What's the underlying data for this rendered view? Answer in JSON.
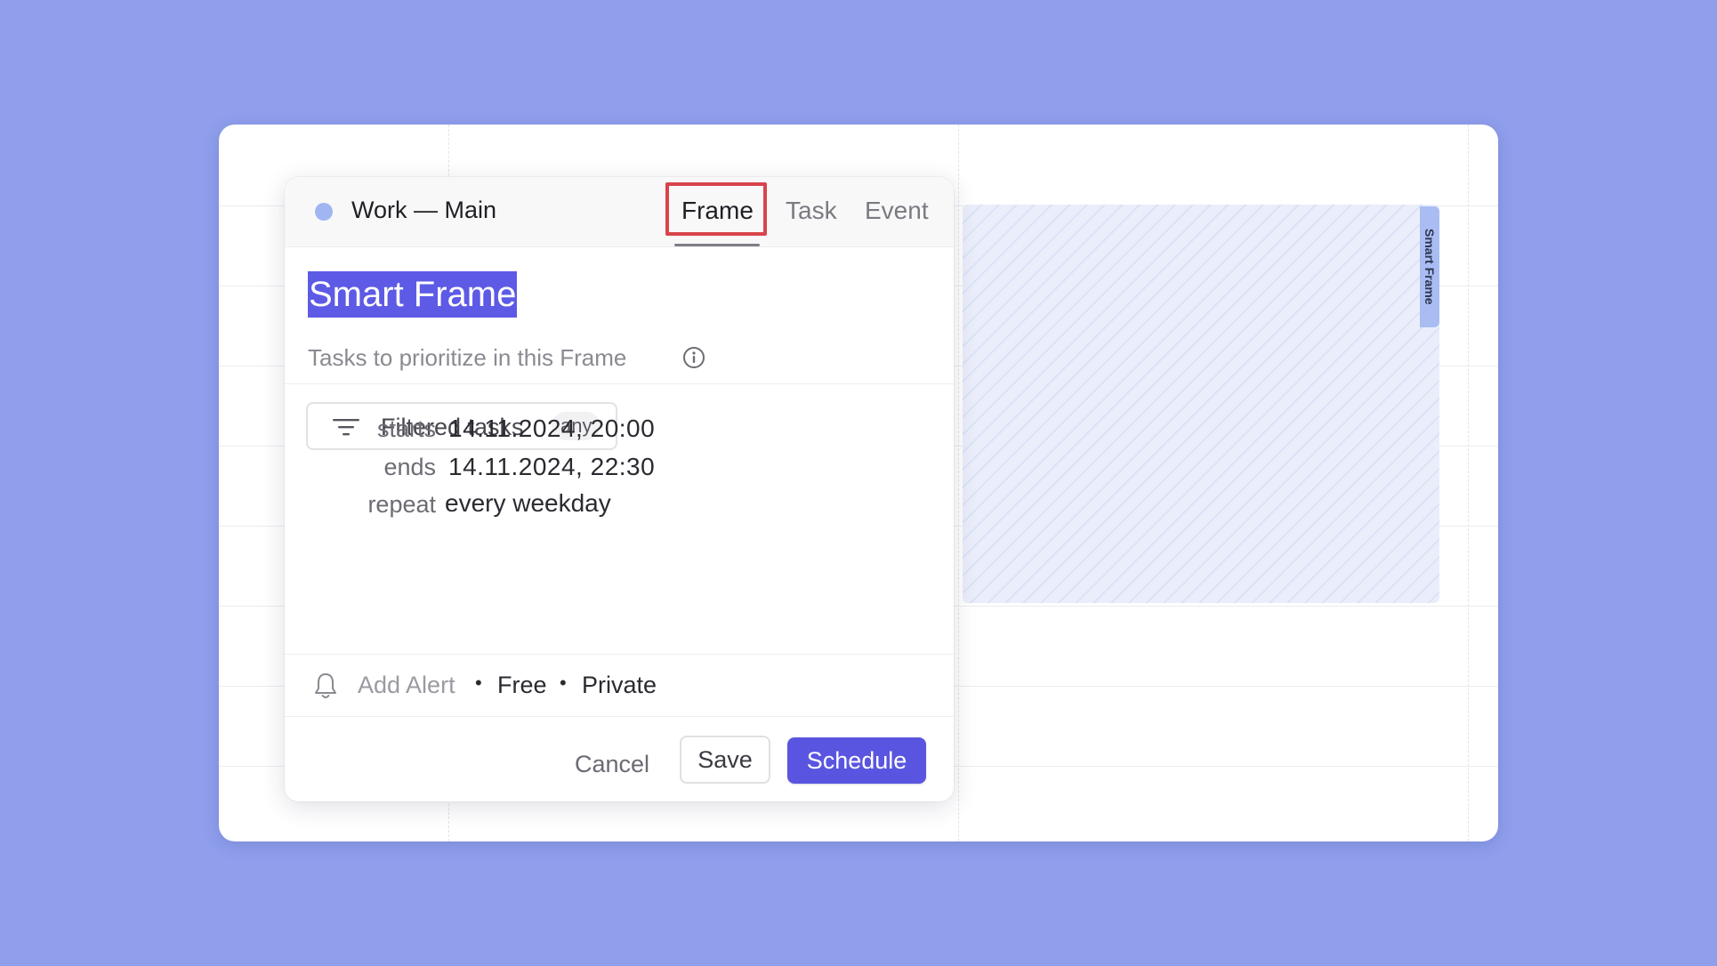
{
  "colors": {
    "background": "#8f9fec",
    "accent": "#5a55e0",
    "calendar_dot": "#9fb6f0",
    "highlight_box": "#d9434b"
  },
  "frame_block": {
    "tag_label": "Smart Frame"
  },
  "dialog": {
    "calendar_name": "Work — Main",
    "tabs": [
      {
        "label": "Frame",
        "active": true
      },
      {
        "label": "Task",
        "active": false
      },
      {
        "label": "Event",
        "active": false
      }
    ],
    "title": "Smart Frame",
    "subtitle": "Tasks to prioritize in this Frame",
    "filter": {
      "label": "Filtered tasks",
      "badge": "any"
    },
    "schedule": {
      "starts_label": "starts",
      "starts_value": "14.11.2024, 20:00",
      "ends_label": "ends",
      "ends_value": "14.11.2024, 22:30",
      "repeat_label": "repeat",
      "repeat_value": "every weekday"
    },
    "alert_row": {
      "add_alert": "Add Alert",
      "separator": "•",
      "availability": "Free",
      "visibility": "Private"
    },
    "buttons": {
      "cancel": "Cancel",
      "save": "Save",
      "schedule": "Schedule"
    }
  }
}
